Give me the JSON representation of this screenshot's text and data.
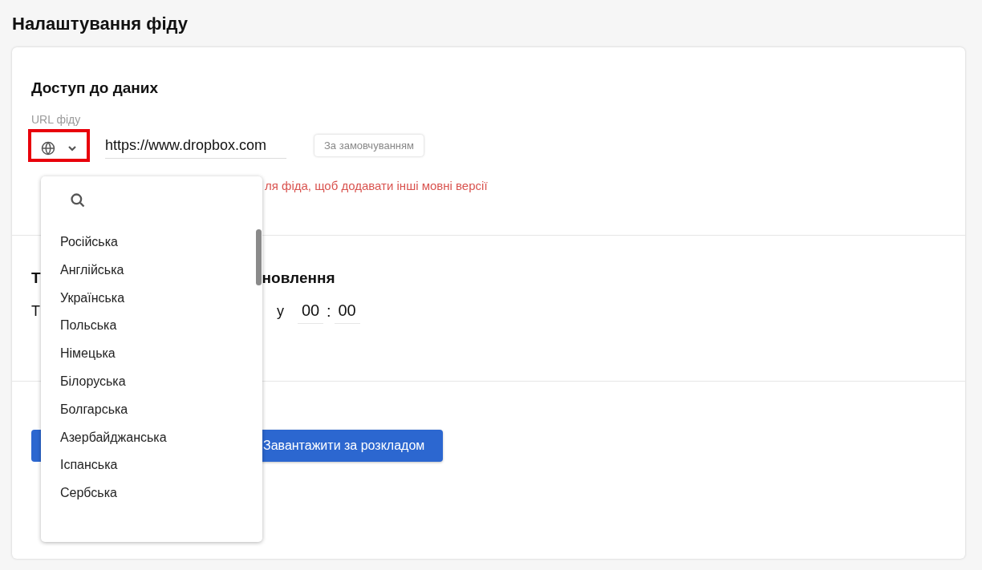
{
  "page_title": "Налаштування фіду",
  "data_access": {
    "title": "Доступ до даних",
    "url_label": "URL фіду",
    "url_value": "https://www.dropbox.com",
    "default_badge": "За замовчуванням",
    "hint": "ля фіда, щоб додавати інші мовні версії"
  },
  "update": {
    "title_start": "Т",
    "title_end": "новлення",
    "row_start": "Т",
    "at": "у",
    "hours": "00",
    "separator": ":",
    "minutes": "00"
  },
  "buttons": [
    {
      "label": "Завантажити за розкладом"
    }
  ],
  "language_dropdown": {
    "items": [
      {
        "label": "Російська"
      },
      {
        "label": "Англійська"
      },
      {
        "label": "Українська"
      },
      {
        "label": "Польська"
      },
      {
        "label": "Німецька"
      },
      {
        "label": "Білоруська"
      },
      {
        "label": "Болгарська"
      },
      {
        "label": "Азербайджанська"
      },
      {
        "label": "Іспанська"
      },
      {
        "label": "Сербська"
      }
    ]
  }
}
